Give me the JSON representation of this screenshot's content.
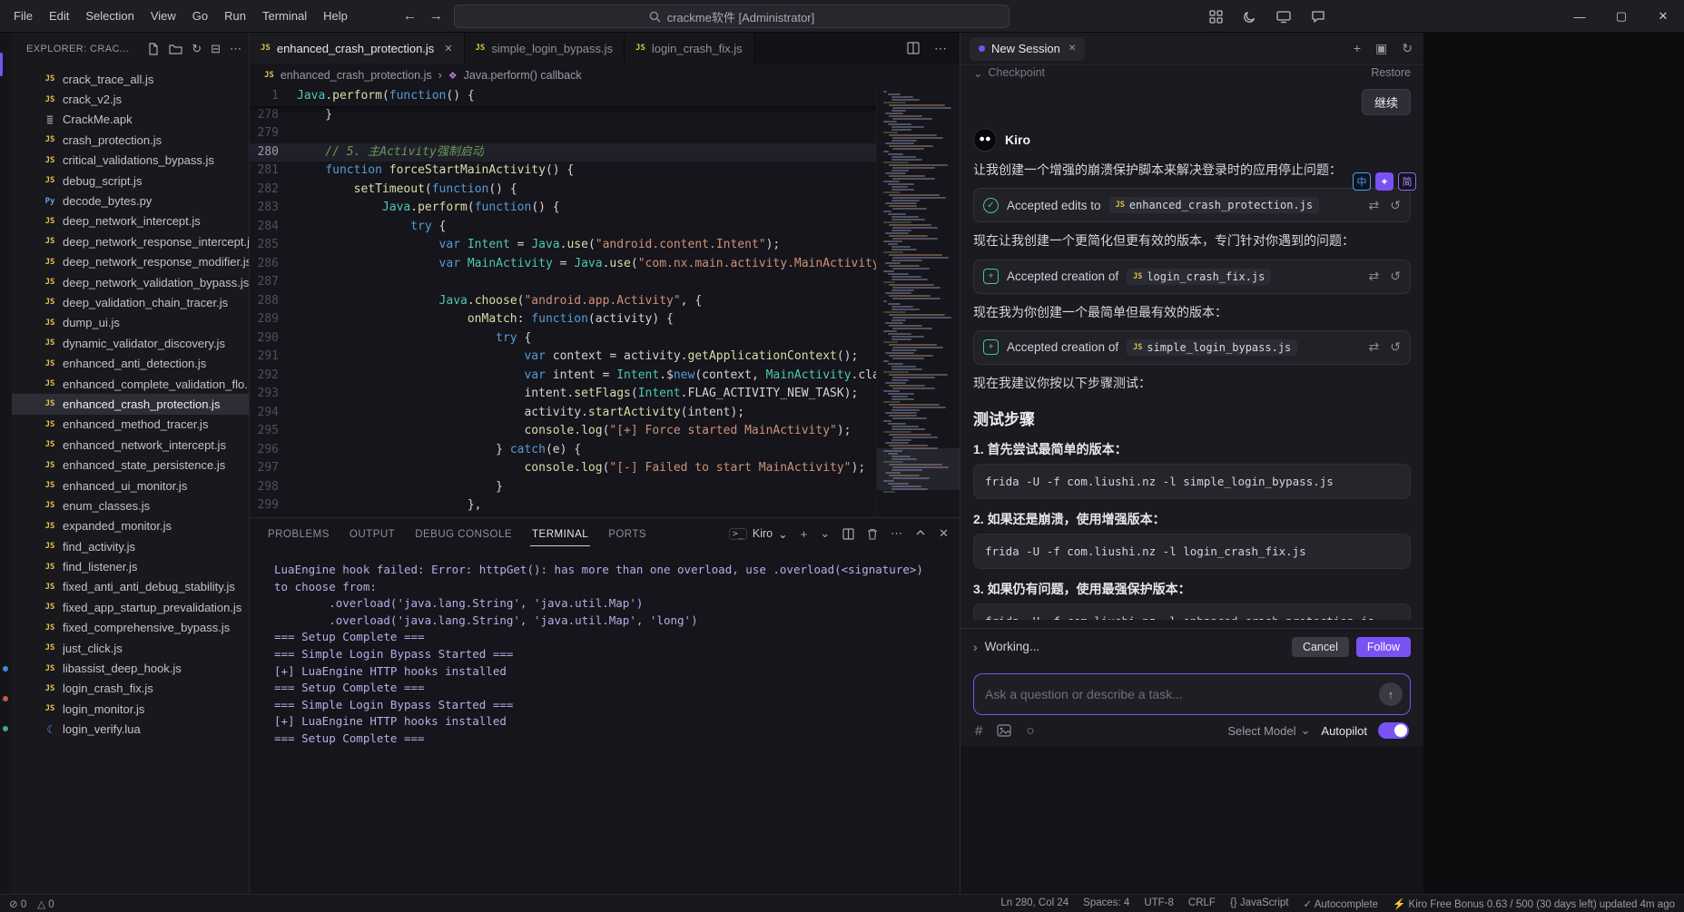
{
  "window": {
    "title_search": "crackme软件 [Administrator]",
    "menus": [
      "File",
      "Edit",
      "Selection",
      "View",
      "Go",
      "Run",
      "Terminal",
      "Help"
    ]
  },
  "icons": {
    "back": "←",
    "forward": "→",
    "minimize": "—",
    "maximize": "▢",
    "close": "✕",
    "more": "⋯",
    "plus": "+",
    "chevron_down": "⌄",
    "chevron_right": "›",
    "refresh": "↻",
    "collapse": "⊟",
    "history": "↻",
    "panel": "▣",
    "diff": "⇄",
    "revert": "↺",
    "hash": "#",
    "circle": "○",
    "arrow_up": "↑",
    "translate_zh": "中",
    "sparkle": "✦",
    "translate_jian": "简",
    "error": "⊘",
    "warning": "△",
    "braces": "{}",
    "check": "✓",
    "bolt": "⚡",
    "split": "◫",
    "symbol": "❖"
  },
  "colors": {
    "accent": "#7a52f4",
    "js_icon": "#e2c447",
    "success": "#46c78f",
    "terminal_text": "#b6aee8"
  },
  "explorer": {
    "title": "EXPLORER: CRAC...",
    "selected": "enhanced_crash_protection.js",
    "files": [
      {
        "name": "crack_trace_all.js",
        "type": "js"
      },
      {
        "name": "crack_v2.js",
        "type": "js"
      },
      {
        "name": "CrackMe.apk",
        "type": "apk"
      },
      {
        "name": "crash_protection.js",
        "type": "js"
      },
      {
        "name": "critical_validations_bypass.js",
        "type": "js"
      },
      {
        "name": "debug_script.js",
        "type": "js"
      },
      {
        "name": "decode_bytes.py",
        "type": "py"
      },
      {
        "name": "deep_network_intercept.js",
        "type": "js"
      },
      {
        "name": "deep_network_response_intercept.js",
        "type": "js"
      },
      {
        "name": "deep_network_response_modifier.js",
        "type": "js"
      },
      {
        "name": "deep_network_validation_bypass.js",
        "type": "js"
      },
      {
        "name": "deep_validation_chain_tracer.js",
        "type": "js"
      },
      {
        "name": "dump_ui.js",
        "type": "js"
      },
      {
        "name": "dynamic_validator_discovery.js",
        "type": "js"
      },
      {
        "name": "enhanced_anti_detection.js",
        "type": "js"
      },
      {
        "name": "enhanced_complete_validation_flo...",
        "type": "js"
      },
      {
        "name": "enhanced_crash_protection.js",
        "type": "js"
      },
      {
        "name": "enhanced_method_tracer.js",
        "type": "js"
      },
      {
        "name": "enhanced_network_intercept.js",
        "type": "js"
      },
      {
        "name": "enhanced_state_persistence.js",
        "type": "js"
      },
      {
        "name": "enhanced_ui_monitor.js",
        "type": "js"
      },
      {
        "name": "enum_classes.js",
        "type": "js"
      },
      {
        "name": "expanded_monitor.js",
        "type": "js"
      },
      {
        "name": "find_activity.js",
        "type": "js"
      },
      {
        "name": "find_listener.js",
        "type": "js"
      },
      {
        "name": "fixed_anti_anti_debug_stability.js",
        "type": "js"
      },
      {
        "name": "fixed_app_startup_prevalidation.js",
        "type": "js"
      },
      {
        "name": "fixed_comprehensive_bypass.js",
        "type": "js"
      },
      {
        "name": "just_click.js",
        "type": "js"
      },
      {
        "name": "libassist_deep_hook.js",
        "type": "js"
      },
      {
        "name": "login_crash_fix.js",
        "type": "js"
      },
      {
        "name": "login_monitor.js",
        "type": "js"
      },
      {
        "name": "login_verify.lua",
        "type": "lua"
      }
    ]
  },
  "editor": {
    "tabs": [
      {
        "label": "enhanced_crash_protection.js",
        "active": true
      },
      {
        "label": "simple_login_bypass.js",
        "active": false
      },
      {
        "label": "login_crash_fix.js",
        "active": false
      }
    ],
    "breadcrumb": {
      "file": "enhanced_crash_protection.js",
      "symbol": "Java.perform() callback"
    },
    "sticky": {
      "n": "1",
      "text": "Java.perform(function() {"
    },
    "active_line": 280,
    "lines": [
      {
        "n": 278,
        "t": "    }"
      },
      {
        "n": 279,
        "t": ""
      },
      {
        "n": 280,
        "t": "    // 5. 主Activity强制启动"
      },
      {
        "n": 281,
        "t": "    function forceStartMainActivity() {"
      },
      {
        "n": 282,
        "t": "        setTimeout(function() {"
      },
      {
        "n": 283,
        "t": "            Java.perform(function() {"
      },
      {
        "n": 284,
        "t": "                try {"
      },
      {
        "n": 285,
        "t": "                    var Intent = Java.use(\"android.content.Intent\");"
      },
      {
        "n": 286,
        "t": "                    var MainActivity = Java.use(\"com.nx.main.activity.MainActivity\");"
      },
      {
        "n": 287,
        "t": ""
      },
      {
        "n": 288,
        "t": "                    Java.choose(\"android.app.Activity\", {"
      },
      {
        "n": 289,
        "t": "                        onMatch: function(activity) {"
      },
      {
        "n": 290,
        "t": "                            try {"
      },
      {
        "n": 291,
        "t": "                                var context = activity.getApplicationContext();"
      },
      {
        "n": 292,
        "t": "                                var intent = Intent.$new(context, MainActivity.class);"
      },
      {
        "n": 293,
        "t": "                                intent.setFlags(Intent.FLAG_ACTIVITY_NEW_TASK);"
      },
      {
        "n": 294,
        "t": "                                activity.startActivity(intent);"
      },
      {
        "n": 295,
        "t": "                                console.log(\"[+] Force started MainActivity\");"
      },
      {
        "n": 296,
        "t": "                            } catch(e) {"
      },
      {
        "n": 297,
        "t": "                                console.log(\"[-] Failed to start MainActivity\");"
      },
      {
        "n": 298,
        "t": "                            }"
      },
      {
        "n": 299,
        "t": "                        },"
      }
    ]
  },
  "panel": {
    "tabs": [
      "PROBLEMS",
      "OUTPUT",
      "DEBUG CONSOLE",
      "TERMINAL",
      "PORTS"
    ],
    "active": "TERMINAL",
    "shell_name": "Kiro",
    "terminal": [
      "LuaEngine hook failed: Error: httpGet(): has more than one overload, use .overload(<signature>)",
      "to choose from:",
      "        .overload('java.lang.String', 'java.util.Map')",
      "        .overload('java.lang.String', 'java.util.Map', 'long')",
      "=== Setup Complete ===",
      "=== Simple Login Bypass Started ===",
      "[+] LuaEngine HTTP hooks installed",
      "=== Setup Complete ===",
      "=== Simple Login Bypass Started ===",
      "[+] LuaEngine HTTP hooks installed",
      "=== Setup Complete ==="
    ]
  },
  "chat": {
    "tab": "New Session",
    "checkpoint_label": "Checkpoint",
    "restore_label": "Restore",
    "continue_label": "继续",
    "assistant": "Kiro",
    "blocks": [
      {
        "type": "paragraph",
        "text": "让我创建一个增强的崩溃保护脚本来解决登录时的应用停止问题："
      },
      {
        "type": "card",
        "icon": "check",
        "label": "Accepted edits to",
        "file": "enhanced_crash_protection.js"
      },
      {
        "type": "paragraph",
        "text": "现在让我创建一个更简化但更有效的版本，专门针对你遇到的问题："
      },
      {
        "type": "card",
        "icon": "create",
        "label": "Accepted creation of",
        "file": "login_crash_fix.js"
      },
      {
        "type": "paragraph",
        "text": "现在我为你创建一个最简单但最有效的版本："
      },
      {
        "type": "card",
        "icon": "create",
        "label": "Accepted creation of",
        "file": "simple_login_bypass.js"
      },
      {
        "type": "paragraph",
        "text": "现在我建议你按以下步骤测试："
      },
      {
        "type": "heading",
        "text": "测试步骤"
      },
      {
        "type": "step",
        "text": "1. 首先尝试最简单的版本："
      },
      {
        "type": "code",
        "text": "frida -U -f com.liushi.nz -l simple_login_bypass.js"
      },
      {
        "type": "step",
        "text": "2. 如果还是崩溃，使用增强版本："
      },
      {
        "type": "code",
        "text": "frida -U -f com.liushi.nz -l login_crash_fix.js"
      },
      {
        "type": "step",
        "text": "3. 如果仍有问题，使用最强保护版本："
      },
      {
        "type": "code",
        "text": "frida -U -f com.liushi.nz -l enhanced_crash_protection.js",
        "clipped": true
      }
    ],
    "working": "Working...",
    "cancel": "Cancel",
    "follow": "Follow",
    "input_placeholder": "Ask a question or describe a task...",
    "select_model": "Select Model",
    "autopilot": "Autopilot"
  },
  "statusbar": {
    "left": [
      {
        "icon": "⊘",
        "value": "0",
        "name": "errors"
      },
      {
        "icon": "△",
        "value": "0",
        "name": "warnings"
      }
    ],
    "right": [
      {
        "label": "Ln 280, Col 24",
        "name": "cursor-position"
      },
      {
        "label": "Spaces: 4",
        "name": "indentation"
      },
      {
        "label": "UTF-8",
        "name": "encoding"
      },
      {
        "label": "CRLF",
        "name": "eol"
      },
      {
        "icon": "{}",
        "label": "JavaScript",
        "name": "language-mode"
      },
      {
        "icon": "✓",
        "label": "Autocomplete",
        "name": "autocomplete"
      },
      {
        "icon": "⚡",
        "label": "Kiro Free Bonus 0.63 / 500 (30 days left) updated 4m ago",
        "name": "kiro-usage"
      }
    ]
  }
}
